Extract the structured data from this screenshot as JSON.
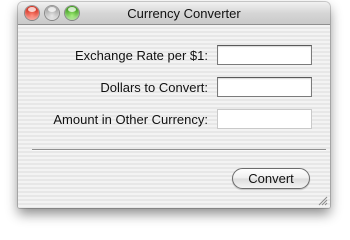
{
  "window": {
    "title": "Currency Converter"
  },
  "form": {
    "rows": [
      {
        "label": "Exchange Rate per $1:",
        "value": "",
        "placeholder": ""
      },
      {
        "label": "Dollars to Convert:",
        "value": "",
        "placeholder": ""
      },
      {
        "label": "Amount in Other Currency:",
        "value": "",
        "placeholder": ""
      }
    ]
  },
  "actions": {
    "convert_label": "Convert"
  },
  "icons": {
    "close": "close-icon",
    "minimize": "minimize-icon",
    "zoom": "zoom-icon",
    "resize": "resize-grip-icon"
  },
  "colors": {
    "close_red": "#d32c1c",
    "minimize_gray": "#a0a0a0",
    "zoom_green": "#3a9a18"
  }
}
